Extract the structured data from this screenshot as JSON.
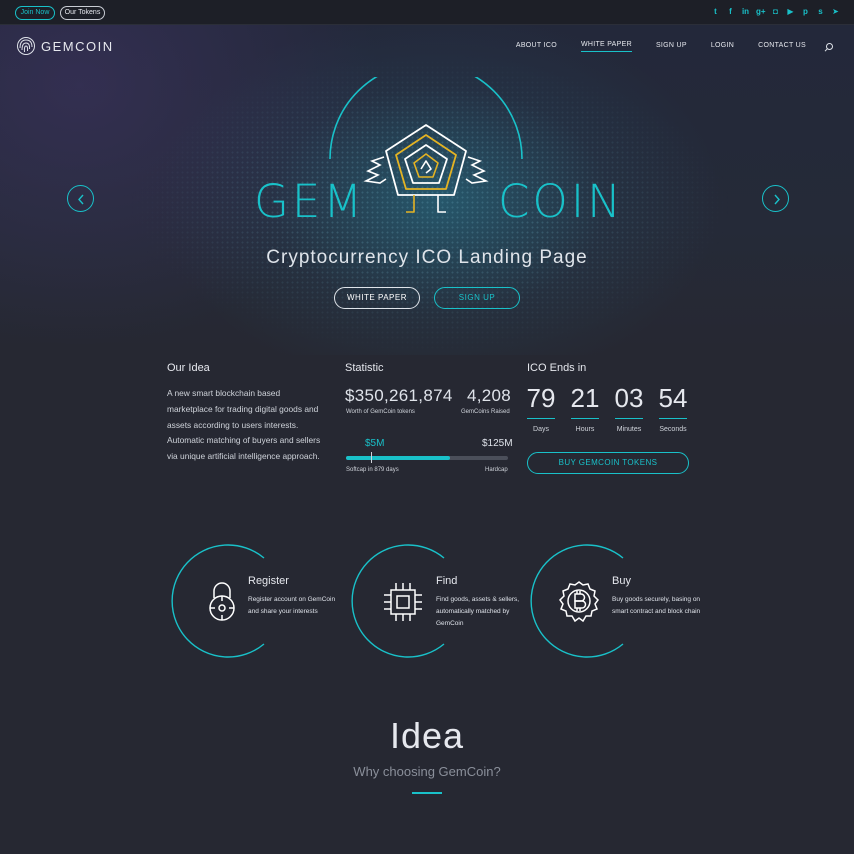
{
  "topbar": {
    "join_label": "Join Now",
    "tokens_label": "Our Tokens",
    "social_icons": [
      "twitter-icon",
      "facebook-icon",
      "linkedin-icon",
      "googleplus-icon",
      "instagram-icon",
      "youtube-icon",
      "pinterest-icon",
      "skype-icon",
      "telegram-icon"
    ],
    "social_glyphs": [
      "t",
      "f",
      "in",
      "g+",
      "◘",
      "▶",
      "p",
      "s",
      "➤"
    ]
  },
  "header": {
    "logo_text": "GEMCOIN",
    "nav": [
      "ABOUT ICO",
      "WHITE PAPER",
      "SIGN UP",
      "LOGIN",
      "CONTACT US"
    ],
    "active_nav": "WHITE PAPER"
  },
  "hero": {
    "word_left": "GEM",
    "word_right": "COIN",
    "subtitle": "Cryptocurrency ICO Landing Page",
    "btn_white_paper": "WHITE PAPER",
    "btn_sign_up": "SIGN UP"
  },
  "idea": {
    "title": "Our Idea",
    "text": "A new smart blockchain based marketplace for trading digital goods and assets according to users interests. Automatic matching of buyers and sellers via unique artificial intelligence approach."
  },
  "statistic": {
    "title": "Statistic",
    "worth_value": "$350,261,874",
    "worth_label": "Worth of GemCoin tokens",
    "raised_value": "4,208",
    "raised_label": "GemCoins Raised",
    "softcap_value": "$5M",
    "hardcap_value": "$125M",
    "softcap_label": "Softcap in 879 days",
    "hardcap_label": "Hardcap",
    "progress_fraction": 0.64
  },
  "ico": {
    "title": "ICO Ends in",
    "days": "79",
    "days_label": "Days",
    "hours": "21",
    "hours_label": "Hours",
    "minutes": "03",
    "minutes_label": "Minutes",
    "seconds": "54",
    "seconds_label": "Seconds",
    "buy_label": "BUY GEMCOIN TOKENS"
  },
  "features": [
    {
      "title": "Register",
      "text": "Register account on GemCoin and share your interests"
    },
    {
      "title": "Find",
      "text": "Find goods, assets & sellers, automatically matched by GemCoin"
    },
    {
      "title": "Buy",
      "text": "Buy goods securely, basing on smart contract and block chain"
    }
  ],
  "section": {
    "heading": "Idea",
    "subheading": "Why choosing GemCoin?"
  },
  "colors": {
    "accent": "#19c1c9",
    "gold": "#e4b323",
    "background": "#262832"
  }
}
